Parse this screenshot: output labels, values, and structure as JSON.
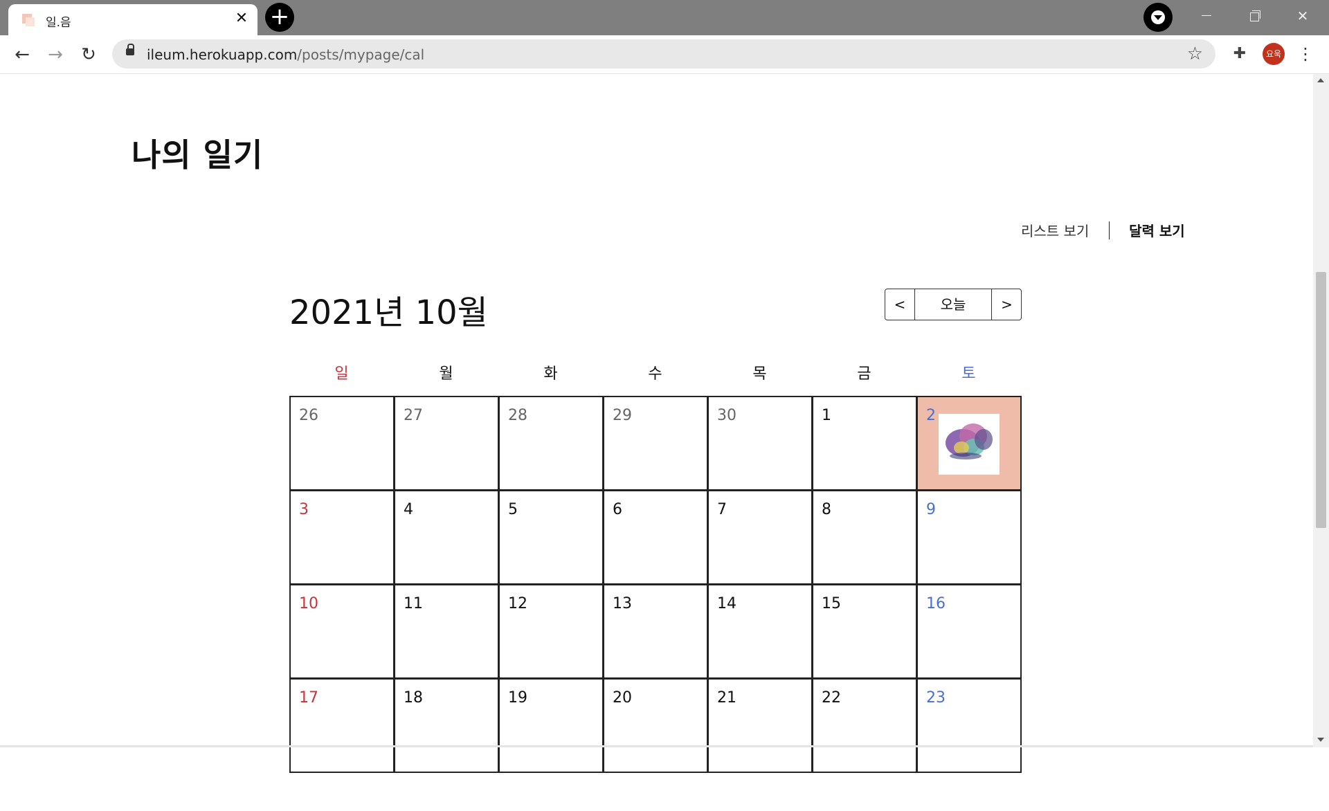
{
  "browser": {
    "tab_title": "일.음",
    "tab_close": "✕",
    "new_tab": "+",
    "url_domain": "ileum.herokuapp.com",
    "url_path": "/posts/mypage/cal",
    "avatar_text": "요욱",
    "icons": [
      "back-icon",
      "forward-icon",
      "reload-icon",
      "lock-icon",
      "star-icon",
      "extensions-icon",
      "menu-icon",
      "profile-download-icon"
    ]
  },
  "page": {
    "title": "나의 일기",
    "view_list": "리스트 보기",
    "view_calendar": "달력 보기"
  },
  "calendar": {
    "month_title": "2021년 10월",
    "prev": "<",
    "today": "오늘",
    "next": ">",
    "weekdays": [
      "일",
      "월",
      "화",
      "수",
      "목",
      "금",
      "토"
    ],
    "weeks": [
      [
        "26",
        "27",
        "28",
        "29",
        "30",
        "1",
        "2"
      ],
      [
        "3",
        "4",
        "5",
        "6",
        "7",
        "8",
        "9"
      ],
      [
        "10",
        "11",
        "12",
        "13",
        "14",
        "15",
        "16"
      ],
      [
        "17",
        "18",
        "19",
        "20",
        "21",
        "22",
        "23"
      ]
    ],
    "colors": {
      "sunday": "#c8343b",
      "saturday": "#4a6fd1",
      "entry_highlight": "#eebca9"
    }
  }
}
